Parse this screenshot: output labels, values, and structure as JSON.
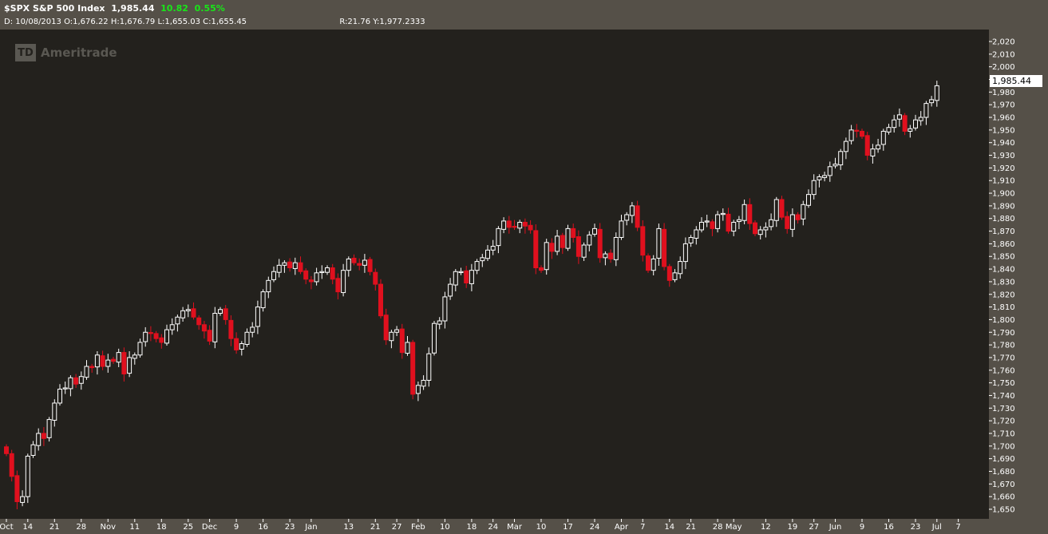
{
  "header": {
    "symbol": "$SPX",
    "name": "S&P 500 Index",
    "last": "1,985.44",
    "change": "10.82",
    "change_pct": "0.55%",
    "date": "D: 10/08/2013",
    "open": "O:1,676.22",
    "high": "H:1,676.79",
    "low": "L:1,655.03",
    "close": "C:1,655.45",
    "r": "R:21.76",
    "y": "Y:1,977.2333"
  },
  "watermark": {
    "box": "TD",
    "text": "Ameritrade"
  },
  "last_price_label": "1,985.44",
  "colors": {
    "up_body": "#23211d",
    "up_outline": "#ffffff",
    "down_body": "#e0101e",
    "background": "#23211d",
    "frame": "#555048",
    "change": "#19e619"
  },
  "chart_data": {
    "type": "candlestick",
    "ylim": [
      1645,
      2025
    ],
    "y_ticks": [
      1650,
      1660,
      1670,
      1680,
      1690,
      1700,
      1710,
      1720,
      1730,
      1740,
      1750,
      1760,
      1770,
      1780,
      1790,
      1800,
      1810,
      1820,
      1830,
      1840,
      1850,
      1860,
      1870,
      1880,
      1890,
      1900,
      1910,
      1920,
      1930,
      1940,
      1950,
      1960,
      1970,
      1980,
      1990,
      2000,
      2010,
      2020
    ],
    "x_ticks": [
      {
        "i": 0,
        "label": "Oct"
      },
      {
        "i": 4,
        "label": "14"
      },
      {
        "i": 9,
        "label": "21"
      },
      {
        "i": 14,
        "label": "28"
      },
      {
        "i": 19,
        "label": "Nov"
      },
      {
        "i": 24,
        "label": "11"
      },
      {
        "i": 29,
        "label": "18"
      },
      {
        "i": 34,
        "label": "25"
      },
      {
        "i": 38,
        "label": "Dec"
      },
      {
        "i": 43,
        "label": "9"
      },
      {
        "i": 48,
        "label": "16"
      },
      {
        "i": 53,
        "label": "23"
      },
      {
        "i": 57,
        "label": "Jan"
      },
      {
        "i": 64,
        "label": "13"
      },
      {
        "i": 69,
        "label": "21"
      },
      {
        "i": 73,
        "label": "27"
      },
      {
        "i": 77,
        "label": "Feb"
      },
      {
        "i": 82,
        "label": "10"
      },
      {
        "i": 87,
        "label": "18"
      },
      {
        "i": 91,
        "label": "24"
      },
      {
        "i": 95,
        "label": "Mar"
      },
      {
        "i": 100,
        "label": "10"
      },
      {
        "i": 105,
        "label": "17"
      },
      {
        "i": 110,
        "label": "24"
      },
      {
        "i": 115,
        "label": "Apr"
      },
      {
        "i": 119,
        "label": "7"
      },
      {
        "i": 124,
        "label": "14"
      },
      {
        "i": 128,
        "label": "21"
      },
      {
        "i": 133,
        "label": "28"
      },
      {
        "i": 136,
        "label": "May"
      },
      {
        "i": 142,
        "label": "12"
      },
      {
        "i": 147,
        "label": "19"
      },
      {
        "i": 151,
        "label": "27"
      },
      {
        "i": 155,
        "label": "Jun"
      },
      {
        "i": 160,
        "label": "9"
      },
      {
        "i": 165,
        "label": "16"
      },
      {
        "i": 170,
        "label": "23"
      },
      {
        "i": 174,
        "label": "Jul"
      },
      {
        "i": 178,
        "label": "7"
      }
    ],
    "closes": [
      1694,
      1676,
      1656,
      1660,
      1692,
      1701,
      1710,
      1706,
      1721,
      1734,
      1745,
      1746,
      1754,
      1749,
      1755,
      1763,
      1762,
      1772,
      1763,
      1768,
      1767,
      1774,
      1757,
      1770,
      1772,
      1782,
      1790,
      1789,
      1785,
      1782,
      1792,
      1796,
      1802,
      1807,
      1808,
      1802,
      1796,
      1791,
      1783,
      1805,
      1808,
      1800,
      1785,
      1776,
      1781,
      1790,
      1794,
      1810,
      1822,
      1831,
      1838,
      1843,
      1845,
      1841,
      1845,
      1838,
      1832,
      1830,
      1837,
      1838,
      1841,
      1832,
      1822,
      1839,
      1848,
      1845,
      1843,
      1847,
      1838,
      1828,
      1803,
      1784,
      1790,
      1792,
      1774,
      1782,
      1741,
      1748,
      1752,
      1773,
      1797,
      1799,
      1818,
      1828,
      1838,
      1838,
      1829,
      1839,
      1846,
      1849,
      1855,
      1858,
      1872,
      1878,
      1873,
      1873,
      1877,
      1874,
      1871,
      1841,
      1839,
      1861,
      1854,
      1866,
      1857,
      1872,
      1865,
      1850,
      1859,
      1867,
      1872,
      1849,
      1852,
      1848,
      1865,
      1878,
      1883,
      1890,
      1873,
      1851,
      1839,
      1848,
      1872,
      1842,
      1831,
      1837,
      1846,
      1860,
      1865,
      1871,
      1877,
      1878,
      1872,
      1883,
      1884,
      1870,
      1877,
      1879,
      1891,
      1876,
      1868,
      1871,
      1873,
      1879,
      1895,
      1881,
      1872,
      1883,
      1879,
      1891,
      1899,
      1910,
      1913,
      1914,
      1921,
      1923,
      1933,
      1941,
      1950,
      1949,
      1945,
      1930,
      1935,
      1938,
      1949,
      1952,
      1958,
      1962,
      1949,
      1951,
      1958,
      1960,
      1971,
      1974,
      1985
    ]
  }
}
